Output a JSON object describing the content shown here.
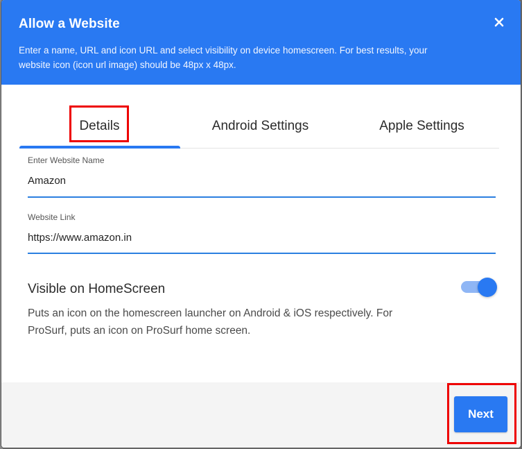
{
  "dialog": {
    "title": "Allow a Website",
    "description": "Enter a name, URL and icon URL and select visibility on device homescreen. For best results, your website icon (icon url image) should be 48px x 48px.",
    "close_icon": "close-icon"
  },
  "tabs": [
    {
      "label": "Details",
      "active": true
    },
    {
      "label": "Android Settings",
      "active": false
    },
    {
      "label": "Apple Settings",
      "active": false
    }
  ],
  "form": {
    "website_name": {
      "label": "Enter Website Name",
      "value": "Amazon"
    },
    "website_link": {
      "label": "Website Link",
      "value": "https://www.amazon.in"
    }
  },
  "visibility": {
    "title": "Visible on HomeScreen",
    "description": "Puts an icon on the homescreen launcher on Android & iOS respectively. For ProSurf, puts an icon on ProSurf home screen.",
    "enabled": true
  },
  "footer": {
    "next_label": "Next"
  },
  "colors": {
    "accent": "#2979f2",
    "highlight": "#ee0000"
  }
}
